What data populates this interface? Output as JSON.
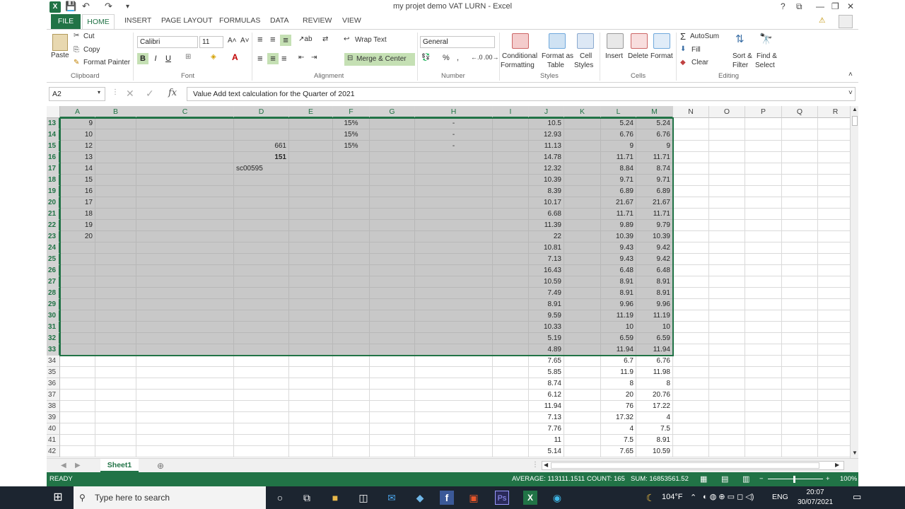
{
  "window": {
    "title": "my projet demo VAT LURN - Excel"
  },
  "titlebar": {
    "help": "?",
    "restore_ribbon": "⧉",
    "minimize": "—",
    "maximize": "❐",
    "close": "✕"
  },
  "tabs": [
    "FILE",
    "HOME",
    "INSERT",
    "PAGE LAYOUT",
    "FORMULAS",
    "DATA",
    "REVIEW",
    "VIEW"
  ],
  "ribbon": {
    "clipboard": {
      "paste": "Paste",
      "cut": "Cut",
      "copy": "Copy",
      "format_painter": "Format Painter",
      "label": "Clipboard"
    },
    "font": {
      "name": "Calibri",
      "size": "11",
      "label": "Font",
      "bold": "B",
      "italic": "I",
      "underline": "U"
    },
    "alignment": {
      "wrap": "Wrap Text",
      "merge": "Merge & Center",
      "label": "Alignment"
    },
    "number": {
      "format": "General",
      "label": "Number",
      "percent": "%",
      "comma": ","
    },
    "styles": {
      "conditional": "Conditional",
      "conditional2": "Formatting",
      "format_as": "Format as",
      "format_as2": "Table",
      "cell": "Cell",
      "cell2": "Styles",
      "label": "Styles"
    },
    "cells": {
      "insert": "Insert",
      "delete": "Delete",
      "format": "Format",
      "label": "Cells"
    },
    "editing": {
      "autosum": "AutoSum",
      "fill": "Fill",
      "clear": "Clear",
      "sort": "Sort &",
      "sort2": "Filter",
      "find": "Find &",
      "find2": "Select",
      "label": "Editing"
    }
  },
  "formula_bar": {
    "name_box": "A2",
    "fx": "fx",
    "content": "Value Add text calculation for the  Quarter of 2021"
  },
  "columns": [
    "A",
    "B",
    "C",
    "D",
    "E",
    "F",
    "G",
    "H",
    "I",
    "J",
    "K",
    "L",
    "M",
    "N",
    "O",
    "P",
    "Q",
    "R"
  ],
  "rows": [
    {
      "n": "13",
      "A": "9",
      "F": "15%",
      "H": "-",
      "J": "10.5",
      "L": "5.24",
      "M": "5.24"
    },
    {
      "n": "14",
      "A": "10",
      "F": "15%",
      "H": "-",
      "J": "12.93",
      "L": "6.76",
      "M": "6.76"
    },
    {
      "n": "15",
      "A": "12",
      "D": "661",
      "F": "15%",
      "H": "-",
      "J": "11.13",
      "L": "9",
      "M": "9"
    },
    {
      "n": "16",
      "A": "13",
      "D": "151",
      "J": "14.78",
      "L": "11.71",
      "M": "11.71"
    },
    {
      "n": "17",
      "A": "14",
      "D": "sc00595",
      "J": "12.32",
      "L": "8.84",
      "M": "8.74"
    },
    {
      "n": "18",
      "A": "15",
      "J": "10.39",
      "L": "9.71",
      "M": "9.71"
    },
    {
      "n": "19",
      "A": "16",
      "J": "8.39",
      "L": "6.89",
      "M": "6.89"
    },
    {
      "n": "20",
      "A": "17",
      "J": "10.17",
      "L": "21.67",
      "M": "21.67"
    },
    {
      "n": "21",
      "A": "18",
      "J": "6.68",
      "L": "11.71",
      "M": "11.71"
    },
    {
      "n": "22",
      "A": "19",
      "J": "11.39",
      "L": "9.89",
      "M": "9.79"
    },
    {
      "n": "23",
      "A": "20",
      "J": "22",
      "L": "10.39",
      "M": "10.39"
    },
    {
      "n": "24",
      "J": "10.81",
      "L": "9.43",
      "M": "9.42"
    },
    {
      "n": "25",
      "J": "7.13",
      "L": "9.43",
      "M": "9.42"
    },
    {
      "n": "26",
      "J": "16.43",
      "L": "6.48",
      "M": "6.48"
    },
    {
      "n": "27",
      "J": "10.59",
      "L": "8.91",
      "M": "8.91"
    },
    {
      "n": "28",
      "J": "7.49",
      "L": "8.91",
      "M": "8.91"
    },
    {
      "n": "29",
      "J": "8.91",
      "L": "9.96",
      "M": "9.96"
    },
    {
      "n": "30",
      "J": "9.59",
      "L": "11.19",
      "M": "11.19"
    },
    {
      "n": "31",
      "J": "10.33",
      "L": "10",
      "M": "10"
    },
    {
      "n": "32",
      "J": "5.19",
      "L": "6.59",
      "M": "6.59"
    },
    {
      "n": "33",
      "J": "4.89",
      "L": "11.94",
      "M": "11.94"
    },
    {
      "n": "34",
      "J": "7.65",
      "L": "6.7",
      "M": "6.76"
    },
    {
      "n": "35",
      "J": "5.85",
      "L": "11.9",
      "M": "11.98"
    },
    {
      "n": "36",
      "J": "8.74",
      "L": "8",
      "M": "8"
    },
    {
      "n": "37",
      "J": "6.12",
      "L": "20",
      "M": "20.76"
    },
    {
      "n": "38",
      "J": "11.94",
      "L": "76",
      "M": "17.22"
    },
    {
      "n": "39",
      "J": "7.13",
      "L": "17.32",
      "M": "4"
    },
    {
      "n": "40",
      "J": "7.76",
      "L": "4",
      "M": "7.5"
    },
    {
      "n": "41",
      "J": "11",
      "L": "7.5",
      "M": "8.91"
    },
    {
      "n": "42",
      "J": "5.14",
      "L": "7.65",
      "M": "10.59"
    }
  ],
  "sheets": [
    "Sheet1"
  ],
  "status": {
    "ready": "READY",
    "average": "AVERAGE: 113111.1511",
    "count": "COUNT: 165",
    "sum": "SUM: 16853561.52",
    "zoom": "100%"
  },
  "taskbar": {
    "search_placeholder": "Type here to search",
    "weather": "104°F",
    "lang": "ENG",
    "time": "20:07",
    "date": "30/07/2021"
  },
  "colors": {
    "accent": "#217346",
    "selection": "#c8c8c8"
  }
}
